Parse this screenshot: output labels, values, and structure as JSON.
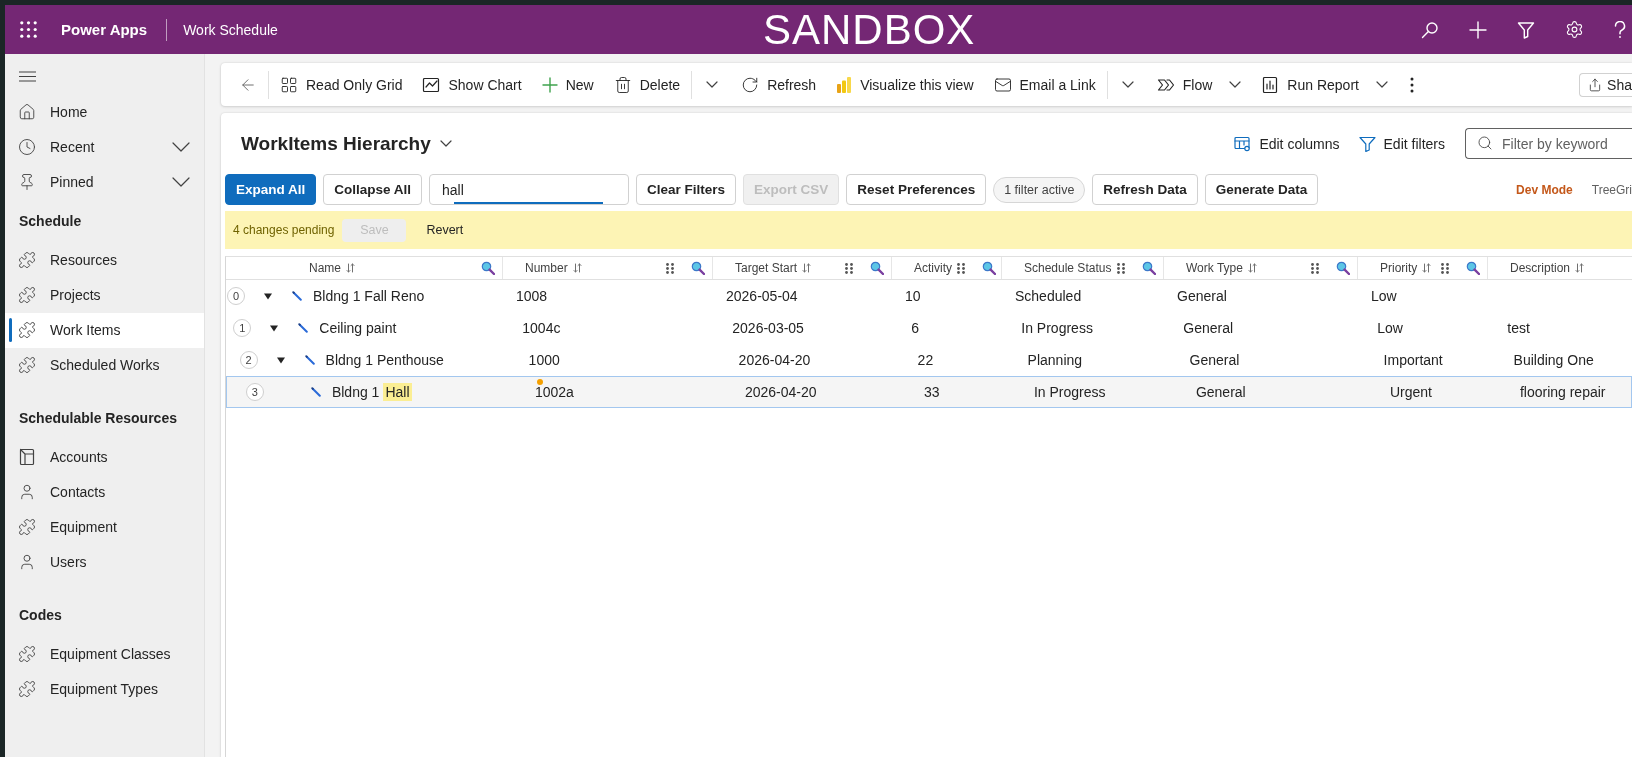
{
  "header": {
    "app_name": "Power Apps",
    "app_title": "Work Schedule",
    "environment": "SANDBOX"
  },
  "sidebar": {
    "top_items": [
      {
        "label": "Home",
        "kind": "home",
        "selected": false
      },
      {
        "label": "Recent",
        "kind": "recent",
        "selected": false,
        "expanded": false
      },
      {
        "label": "Pinned",
        "kind": "pinned",
        "selected": false,
        "expanded": false
      }
    ],
    "groups": [
      {
        "title": "Schedule",
        "items": [
          {
            "label": "Resources",
            "kind": "entity",
            "selected": false
          },
          {
            "label": "Projects",
            "kind": "entity",
            "selected": false
          },
          {
            "label": "Work Items",
            "kind": "entity",
            "selected": true
          },
          {
            "label": "Scheduled Works",
            "kind": "entity",
            "selected": false
          }
        ]
      },
      {
        "title": "Schedulable Resources",
        "items": [
          {
            "label": "Accounts",
            "kind": "account",
            "selected": false
          },
          {
            "label": "Contacts",
            "kind": "person",
            "selected": false
          },
          {
            "label": "Equipment",
            "kind": "entity",
            "selected": false
          },
          {
            "label": "Users",
            "kind": "person",
            "selected": false
          }
        ]
      },
      {
        "title": "Codes",
        "items": [
          {
            "label": "Equipment Classes",
            "kind": "entity",
            "selected": false
          },
          {
            "label": "Equipment Types",
            "kind": "entity",
            "selected": false
          }
        ]
      }
    ]
  },
  "command_bar": {
    "commands": [
      {
        "kind": "grid",
        "label": "Read Only Grid"
      },
      {
        "kind": "chart",
        "label": "Show Chart"
      },
      {
        "kind": "new",
        "label": "New"
      },
      {
        "kind": "delete",
        "label": "Delete",
        "split": true
      },
      {
        "kind": "refresh",
        "label": "Refresh"
      },
      {
        "kind": "visualize",
        "label": "Visualize this view"
      },
      {
        "kind": "email",
        "label": "Email a Link",
        "split": true
      },
      {
        "kind": "flow",
        "label": "Flow",
        "dropdown": true
      },
      {
        "kind": "report",
        "label": "Run Report",
        "dropdown": true
      }
    ],
    "share": {
      "label": "Sha"
    }
  },
  "view": {
    "title": "WorkItems Hierarchy",
    "actions": [
      {
        "kind": "columns",
        "label": "Edit columns"
      },
      {
        "kind": "filters",
        "label": "Edit filters"
      }
    ],
    "keyword_filter": {
      "placeholder": "Filter by keyword"
    }
  },
  "toolbar": {
    "items": [
      {
        "kind": "button",
        "label": "Expand All",
        "primary": true,
        "disabled": false
      },
      {
        "kind": "button",
        "label": "Collapse All",
        "primary": false,
        "disabled": false
      },
      {
        "kind": "search",
        "value": "hall"
      },
      {
        "kind": "button",
        "label": "Clear Filters",
        "primary": false,
        "disabled": false
      },
      {
        "kind": "button",
        "label": "Export CSV",
        "primary": false,
        "disabled": true
      },
      {
        "kind": "button",
        "label": "Reset Preferences",
        "primary": false,
        "disabled": false
      },
      {
        "kind": "pill",
        "label": "1 filter active"
      },
      {
        "kind": "button",
        "label": "Refresh Data",
        "primary": false,
        "disabled": false
      },
      {
        "kind": "button",
        "label": "Generate Data",
        "primary": false,
        "disabled": false
      }
    ],
    "mode_label": "Dev Mode",
    "trailing_text": "TreeGri"
  },
  "pending_bar": {
    "message": "4 changes pending",
    "save": {
      "label": "Save",
      "disabled": true
    },
    "revert": {
      "label": "Revert"
    }
  },
  "grid": {
    "columns": [
      {
        "label": "Name",
        "sortable": true,
        "draggable": false,
        "filterable": true
      },
      {
        "label": "Number",
        "sortable": true,
        "draggable": true,
        "filterable": true
      },
      {
        "label": "Target Start",
        "sortable": true,
        "draggable": true,
        "filterable": true
      },
      {
        "label": "Activity",
        "sortable": false,
        "draggable": true,
        "filterable": true
      },
      {
        "label": "Schedule Status",
        "sortable": false,
        "draggable": true,
        "filterable": true
      },
      {
        "label": "Work Type",
        "sortable": true,
        "draggable": true,
        "filterable": true
      },
      {
        "label": "Priority",
        "sortable": true,
        "draggable": true,
        "filterable": true
      },
      {
        "label": "Description",
        "sortable": true,
        "draggable": false,
        "filterable": false
      }
    ],
    "rows": [
      {
        "level": "0",
        "expanded": true,
        "selected": false,
        "edited": false,
        "cells": [
          [
            {
              "text": "Bldng 1 Fall Reno",
              "highlighted": false
            }
          ],
          "1008",
          "2026-05-04",
          "10",
          "Scheduled",
          "General",
          "Low"
        ],
        "children": [
          {
            "level": "1",
            "expanded": true,
            "selected": false,
            "edited": false,
            "cells": [
              [
                {
                  "text": "Ceiling paint",
                  "highlighted": false
                }
              ],
              "1004c",
              "2026-03-05",
              "6",
              "In Progress",
              "General",
              "Low",
              "test"
            ],
            "children": [
              {
                "level": "2",
                "expanded": true,
                "selected": false,
                "edited": false,
                "cells": [
                  [
                    {
                      "text": "Bldng 1 Penthouse",
                      "highlighted": false
                    }
                  ],
                  "1000",
                  "2026-04-20",
                  "22",
                  "Planning",
                  "General",
                  "Important",
                  "Building One"
                ],
                "children": [
                  {
                    "level": "3",
                    "selected": true,
                    "edited": true,
                    "cells": [
                      [
                        {
                          "text": "Bldng 1",
                          "highlighted": false
                        },
                        {
                          "text": "Hall",
                          "highlighted": true
                        }
                      ],
                      "1002a",
                      "2026-04-20",
                      "33",
                      "In Progress",
                      "General",
                      "Urgent",
                      "flooring repair"
                    ]
                  }
                ]
              }
            ]
          }
        ]
      }
    ]
  }
}
